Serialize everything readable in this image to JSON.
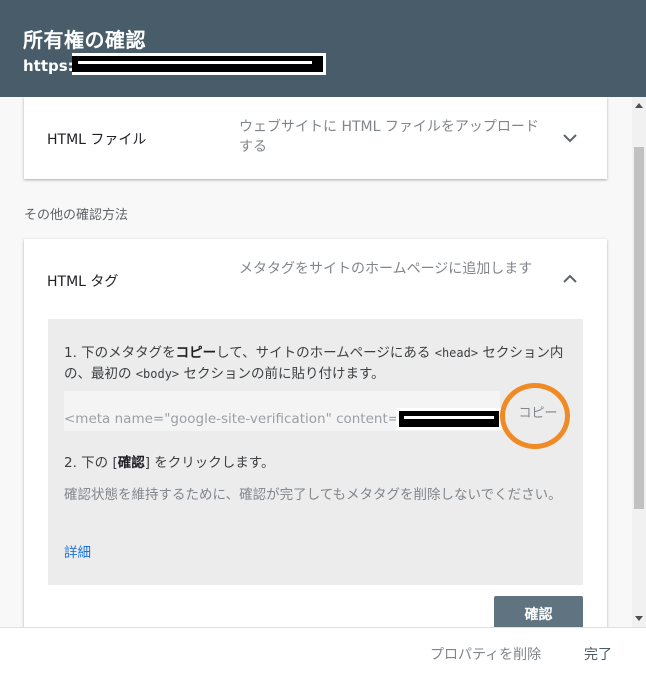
{
  "header": {
    "title": "所有権の確認",
    "url_prefix": "https:/"
  },
  "cards": {
    "html_file": {
      "title": "HTML ファイル",
      "description": "ウェブサイトに HTML ファイルをアップロードする"
    },
    "other_methods_label": "その他の確認方法",
    "html_tag": {
      "title": "HTML タグ",
      "description": "メタタグをサイトのホームページに追加します",
      "step1": {
        "prefix": "1. 下のメタタグを",
        "bold": "コピー",
        "middle": "して、サイトのホームページにある ",
        "head_tag": "<head>",
        "middle2": " セクション内の、最初の ",
        "body_tag": "<body>",
        "suffix": " セクションの前に貼り付けます。"
      },
      "meta_tag": "<meta name=\"google-site-verification\" content=",
      "copy_label": "コピー",
      "step2": {
        "prefix": "2. 下の [",
        "bold": "確認",
        "suffix": "] をクリックします。"
      },
      "note": "確認状態を維持するために、確認が完了してもメタタグを削除しないでください。",
      "details_link": "詳細",
      "confirm_button": "確認"
    }
  },
  "footer": {
    "delete_property": "プロパティを削除",
    "done": "完了"
  },
  "colors": {
    "header_bg": "#485c69",
    "panel_bg": "#ececec",
    "link": "#1a73e8",
    "highlight_circle": "#f08a24",
    "confirm_bg": "#5f7380"
  },
  "icons": {
    "collapse": "chevron-down-icon",
    "expand": "chevron-up-icon"
  }
}
